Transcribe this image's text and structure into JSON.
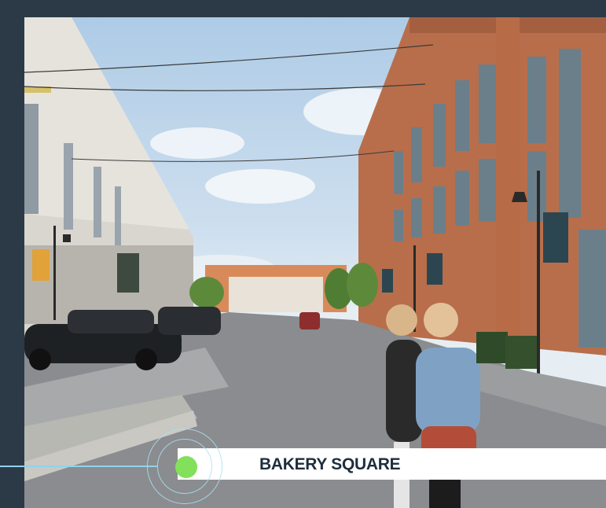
{
  "location_label": "BAKERY SQUARE",
  "icons": {
    "marker": "location-dot-icon",
    "rings": "pulse-ring-icon"
  },
  "colors": {
    "frame_background": "#2c3a47",
    "marker_dot": "#82e05a",
    "marker_rings": "#aae1f5",
    "label_background": "#ffffff",
    "label_text": "#1f2d3d"
  }
}
